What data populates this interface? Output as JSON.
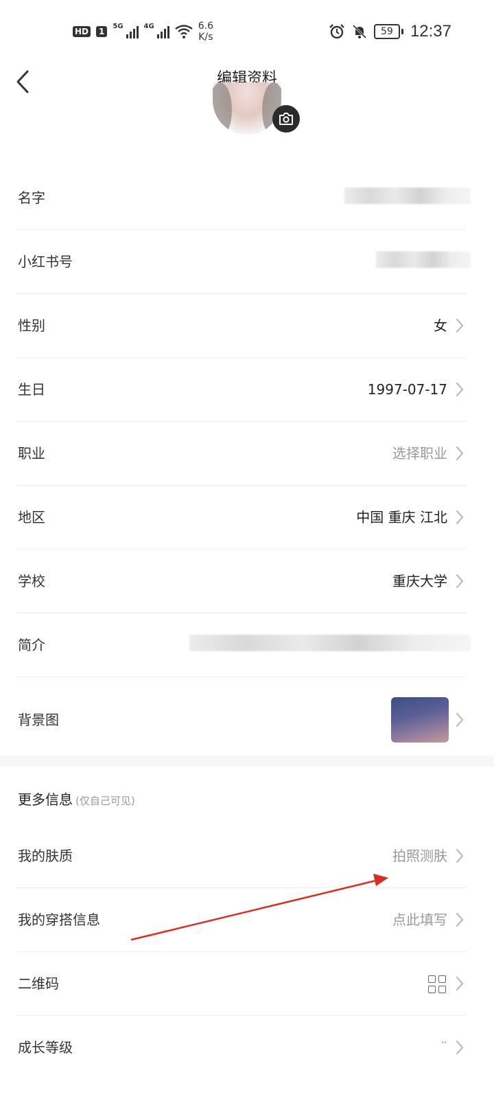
{
  "status_bar": {
    "hd": "HD",
    "sim": "1",
    "net1": "5G",
    "net2": "4G",
    "speed_value": "6.6",
    "speed_unit": "K/s",
    "battery": "59",
    "time": "12:37"
  },
  "header": {
    "title": "编辑资料"
  },
  "profile_rows": [
    {
      "label": "名字",
      "value": ""
    },
    {
      "label": "小红书号",
      "value": ""
    },
    {
      "label": "性别",
      "value": "女"
    },
    {
      "label": "生日",
      "value": "1997-07-17"
    },
    {
      "label": "职业",
      "value": "选择职业"
    },
    {
      "label": "地区",
      "value": "中国 重庆 江北"
    },
    {
      "label": "学校",
      "value": "重庆大学"
    },
    {
      "label": "简介",
      "value": ""
    },
    {
      "label": "背景图",
      "value": ""
    }
  ],
  "more_info": {
    "title": "更多信息",
    "subtitle": "(仅自己可见)",
    "rows": [
      {
        "label": "我的肤质",
        "value": "拍照测肤"
      },
      {
        "label": "我的穿搭信息",
        "value": "点此填写"
      },
      {
        "label": "二维码",
        "value": ""
      },
      {
        "label": "成长等级",
        "value": "¨"
      }
    ]
  },
  "icons": {
    "back": "chevron-left-icon",
    "camera": "camera-icon",
    "chevron": "chevron-right-icon",
    "qr": "qr-code-icon"
  },
  "colors": {
    "annotation_arrow": "#e02a20",
    "muted_text": "#999999",
    "divider": "#efefef"
  }
}
